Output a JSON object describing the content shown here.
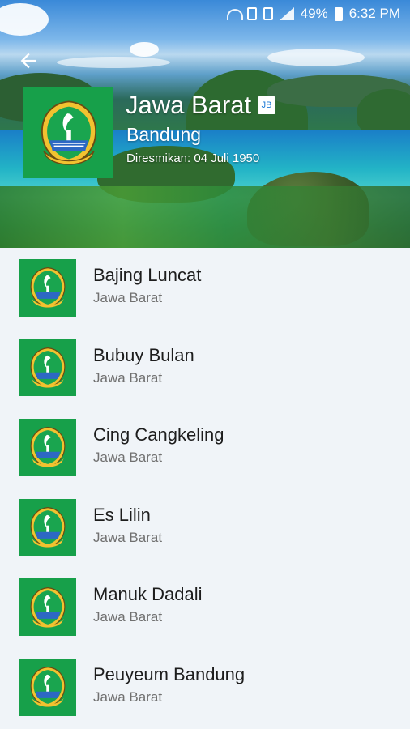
{
  "status_bar": {
    "battery_text": "49%",
    "time": "6:32 PM"
  },
  "header": {
    "province_name": "Jawa Barat",
    "province_badge": "JB",
    "capital": "Bandung",
    "established": "Diresmikan: 04 Juli 1950"
  },
  "list": {
    "items": [
      {
        "title": "Bajing Luncat",
        "subtitle": "Jawa Barat"
      },
      {
        "title": "Bubuy Bulan",
        "subtitle": "Jawa Barat"
      },
      {
        "title": "Cing Cangkeling",
        "subtitle": "Jawa Barat"
      },
      {
        "title": "Es Lilin",
        "subtitle": "Jawa Barat"
      },
      {
        "title": "Manuk Dadali",
        "subtitle": "Jawa Barat"
      },
      {
        "title": "Peuyeum Bandung",
        "subtitle": "Jawa Barat"
      }
    ]
  },
  "icons": {
    "back": "arrow-left-icon",
    "emblem": "jawa-barat-emblem-icon"
  },
  "colors": {
    "emblem_green": "#17a04a",
    "list_background": "#f0f4f8",
    "title_text": "#1d1d1d",
    "subtitle_text": "#707070"
  }
}
